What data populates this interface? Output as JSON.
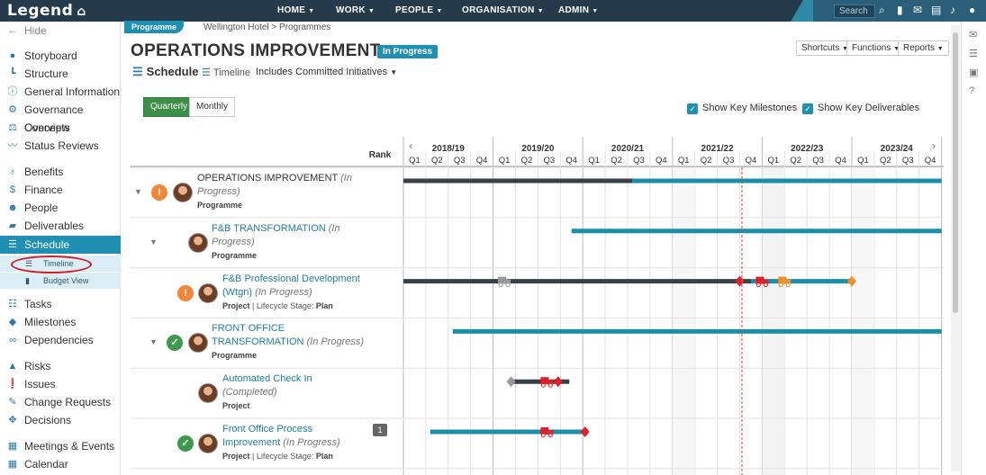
{
  "app": {
    "logo": "Legend"
  },
  "topnav": {
    "items": [
      "HOME",
      "WORK",
      "PEOPLE",
      "ORGANISATION",
      "ADMIN"
    ],
    "search_placeholder": "Search"
  },
  "sidebar": {
    "hide_label": "Hide",
    "items": [
      {
        "label": "Storyboard",
        "icon": "palette-icon"
      },
      {
        "label": "Structure",
        "icon": "structure-icon"
      },
      {
        "label": "General Information",
        "icon": "info-icon"
      },
      {
        "label": "Governance Overview",
        "icon": "governance-icon"
      },
      {
        "label": "Concepts",
        "icon": "scales-icon"
      },
      {
        "label": "Status Reviews",
        "icon": "pulse-icon"
      },
      {
        "label": "Benefits",
        "icon": "ribbon-icon"
      },
      {
        "label": "Finance",
        "icon": "dollar-icon"
      },
      {
        "label": "People",
        "icon": "people-icon"
      },
      {
        "label": "Deliverables",
        "icon": "truck-icon"
      },
      {
        "label": "Schedule",
        "icon": "schedule-icon"
      },
      {
        "label": "Tasks",
        "icon": "tasks-icon"
      },
      {
        "label": "Milestones",
        "icon": "diamond-icon"
      },
      {
        "label": "Dependencies",
        "icon": "link-icon"
      },
      {
        "label": "Risks",
        "icon": "warning-icon"
      },
      {
        "label": "Issues",
        "icon": "issue-icon"
      },
      {
        "label": "Change Requests",
        "icon": "change-icon"
      },
      {
        "label": "Decisions",
        "icon": "decision-icon"
      },
      {
        "label": "Meetings & Events",
        "icon": "meetings-icon"
      },
      {
        "label": "Calendar",
        "icon": "calendar-icon"
      }
    ],
    "sub_items": [
      "Timeline",
      "Budget View"
    ]
  },
  "breadcrumb": {
    "tag": "Programme",
    "path": "Wellington Hotel > Programmes"
  },
  "header": {
    "title": "OPERATIONS IMPROVEMENT",
    "status": "In Progress",
    "buttons": [
      "Shortcuts",
      "Functions",
      "Reports"
    ]
  },
  "view": {
    "schedule_label": "Schedule",
    "timeline_label": "Timeline",
    "filter_label": "Includes Committed Initiatives"
  },
  "toggles": {
    "quarterly": "Quarterly",
    "monthly": "Monthly",
    "show_milestones": "Show Key Milestones",
    "show_deliverables": "Show Key Deliverables"
  },
  "gantt": {
    "rank_label": "Rank",
    "years": [
      "2018/19",
      "2019/20",
      "2020/21",
      "2021/22",
      "2022/23",
      "2023/24"
    ],
    "quarters": [
      "Q1",
      "Q2",
      "Q3",
      "Q4"
    ],
    "today_quarter_index": 15.1,
    "rows": [
      {
        "name": "OPERATIONS IMPROVEMENT",
        "status": "(In Progress)",
        "type": "Programme",
        "stage": "",
        "indicator": "warn",
        "rank": "",
        "bar_start": 0,
        "bar_end": 24,
        "progress_end": 10.2,
        "color": "#1b8fa8",
        "markers": []
      },
      {
        "name": "F&B TRANSFORMATION",
        "status": "(In Progress)",
        "type": "Programme",
        "stage": "",
        "indicator": "",
        "rank": "",
        "bar_start": 7.5,
        "bar_end": 24,
        "progress_end": 7.5,
        "color": "#1b8fa8",
        "markers": []
      },
      {
        "name": "F&B Professional Development (Wtgn)",
        "status": "(In Progress)",
        "type": "Project",
        "stage": "Plan",
        "indicator": "warn",
        "rank": "",
        "bar_start": 0,
        "bar_end": 20,
        "progress_end": 15.5,
        "color": "#1b8fa8",
        "markers": [
          {
            "q": 4.5,
            "kind": "truck",
            "color": "#999999"
          },
          {
            "q": 15,
            "kind": "diamond",
            "color": "#e0202a"
          },
          {
            "q": 16,
            "kind": "truck",
            "color": "#e0202a"
          },
          {
            "q": 17,
            "kind": "truck",
            "color": "#f0902a"
          },
          {
            "q": 20,
            "kind": "diamond",
            "color": "#f0902a"
          }
        ]
      },
      {
        "name": "FRONT OFFICE TRANSFORMATION",
        "status": "(In Progress)",
        "type": "Programme",
        "stage": "",
        "indicator": "ok",
        "rank": "",
        "bar_start": 2.2,
        "bar_end": 24,
        "progress_end": 2.2,
        "color": "#1b8fa8",
        "markers": []
      },
      {
        "name": "Automated Check In",
        "status": "(Completed)",
        "type": "Project",
        "stage": "",
        "indicator": "",
        "rank": "",
        "bar_start": 4.8,
        "bar_end": 7.4,
        "progress_end": 7.4,
        "color": "#1b8fa8",
        "markers": [
          {
            "q": 4.8,
            "kind": "diamond",
            "color": "#999999"
          },
          {
            "q": 6.4,
            "kind": "truck",
            "color": "#e0202a"
          },
          {
            "q": 6.9,
            "kind": "diamond",
            "color": "#e0202a"
          }
        ]
      },
      {
        "name": "Front Office Process Improvement",
        "status": "(In Progress)",
        "type": "Project",
        "stage": "Plan",
        "indicator": "ok",
        "rank": "1",
        "bar_start": 1.2,
        "bar_end": 8.1,
        "progress_end": 1.2,
        "color": "#1b8fa8",
        "markers": [
          {
            "q": 6.4,
            "kind": "truck",
            "color": "#e0202a"
          },
          {
            "q": 8.1,
            "kind": "diamond",
            "color": "#e0202a"
          }
        ]
      }
    ],
    "type_label_project": "Project",
    "lifecycle_label": "Lifecycle Stage:"
  }
}
